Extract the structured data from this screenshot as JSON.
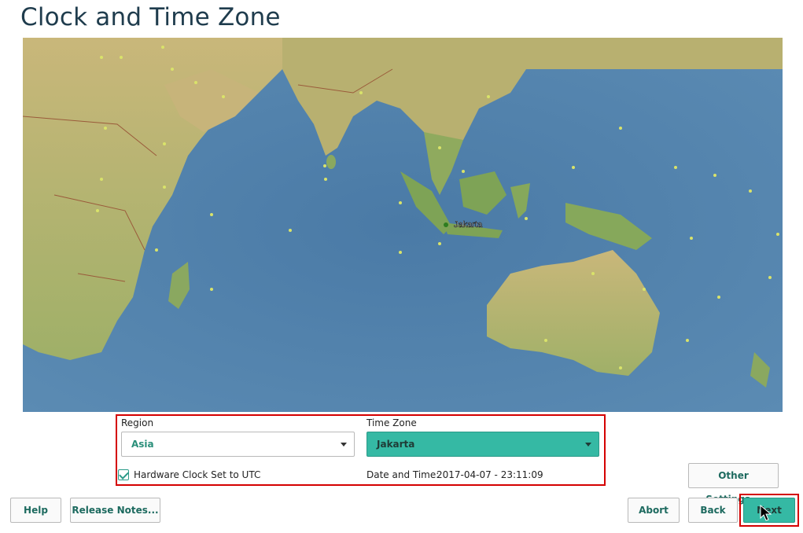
{
  "page": {
    "title": "Clock and Time Zone"
  },
  "map": {
    "city_label": "Jakarta",
    "colors": {
      "ocean": "#4f7fa8",
      "land": "#b8b474",
      "lowland": "#8aa860",
      "border": "#9a5a3a"
    }
  },
  "region": {
    "label": "Region",
    "value": "Asia"
  },
  "timezone": {
    "label": "Time Zone",
    "value": "Jakarta"
  },
  "hardware_clock": {
    "label": "Hardware Clock Set to UTC",
    "checked": true
  },
  "datetime": {
    "label": "Date and Time:",
    "value": "2017-04-07 - 23:11:09"
  },
  "buttons": {
    "other_settings": "Other Settings...",
    "help": "Help",
    "release_notes": "Release Notes...",
    "abort": "Abort",
    "back": "Back",
    "next": "Next"
  },
  "colors": {
    "accent": "#35b9a4",
    "highlight": "#d40000",
    "title": "#1f3c4d"
  }
}
